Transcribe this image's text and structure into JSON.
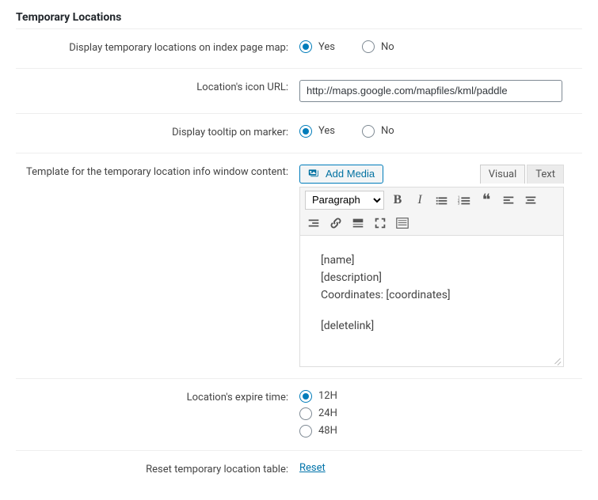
{
  "section_title": "Temporary Locations",
  "rows": {
    "display_map": {
      "label": "Display temporary locations on index page map:",
      "options": {
        "yes": "Yes",
        "no": "No"
      },
      "value": "yes"
    },
    "icon_url": {
      "label": "Location's icon URL:",
      "value": "http://maps.google.com/mapfiles/kml/paddle"
    },
    "tooltip": {
      "label": "Display tooltip on marker:",
      "options": {
        "yes": "Yes",
        "no": "No"
      },
      "value": "yes"
    },
    "template": {
      "label": "Template for the temporary location info window content:",
      "editor": {
        "add_media_label": "Add Media",
        "tabs": {
          "visual": "Visual",
          "text": "Text"
        },
        "format_value": "Paragraph",
        "content_lines": {
          "l1": "[name]",
          "l2": "[description]",
          "l3": "Coordinates: [coordinates]",
          "l4": "[deletelink]"
        }
      }
    },
    "expire": {
      "label": "Location's expire time:",
      "options": {
        "h12": "12H",
        "h24": "24H",
        "h48": "48H"
      },
      "value": "h12"
    },
    "reset": {
      "label": "Reset temporary location table:",
      "link_text": "Reset"
    }
  }
}
